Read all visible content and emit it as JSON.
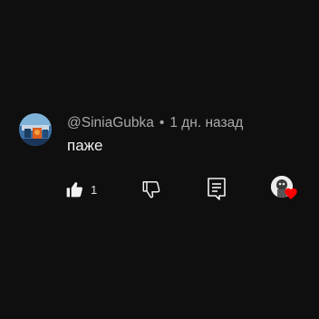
{
  "comment": {
    "author": "@SiniaGubka",
    "separator": "•",
    "timestamp": "1 дн. назад",
    "text": "паже",
    "like_count": "1"
  },
  "icons": {
    "like": "thumbs-up-filled-icon",
    "dislike": "thumbs-down-icon",
    "reply": "reply-comment-icon",
    "hearted": "creator-heart-icon"
  },
  "colors": {
    "background": "#0f0f0f",
    "text_primary": "#f1f1f1",
    "text_secondary": "#aaaaaa",
    "heart": "#ff0000"
  }
}
